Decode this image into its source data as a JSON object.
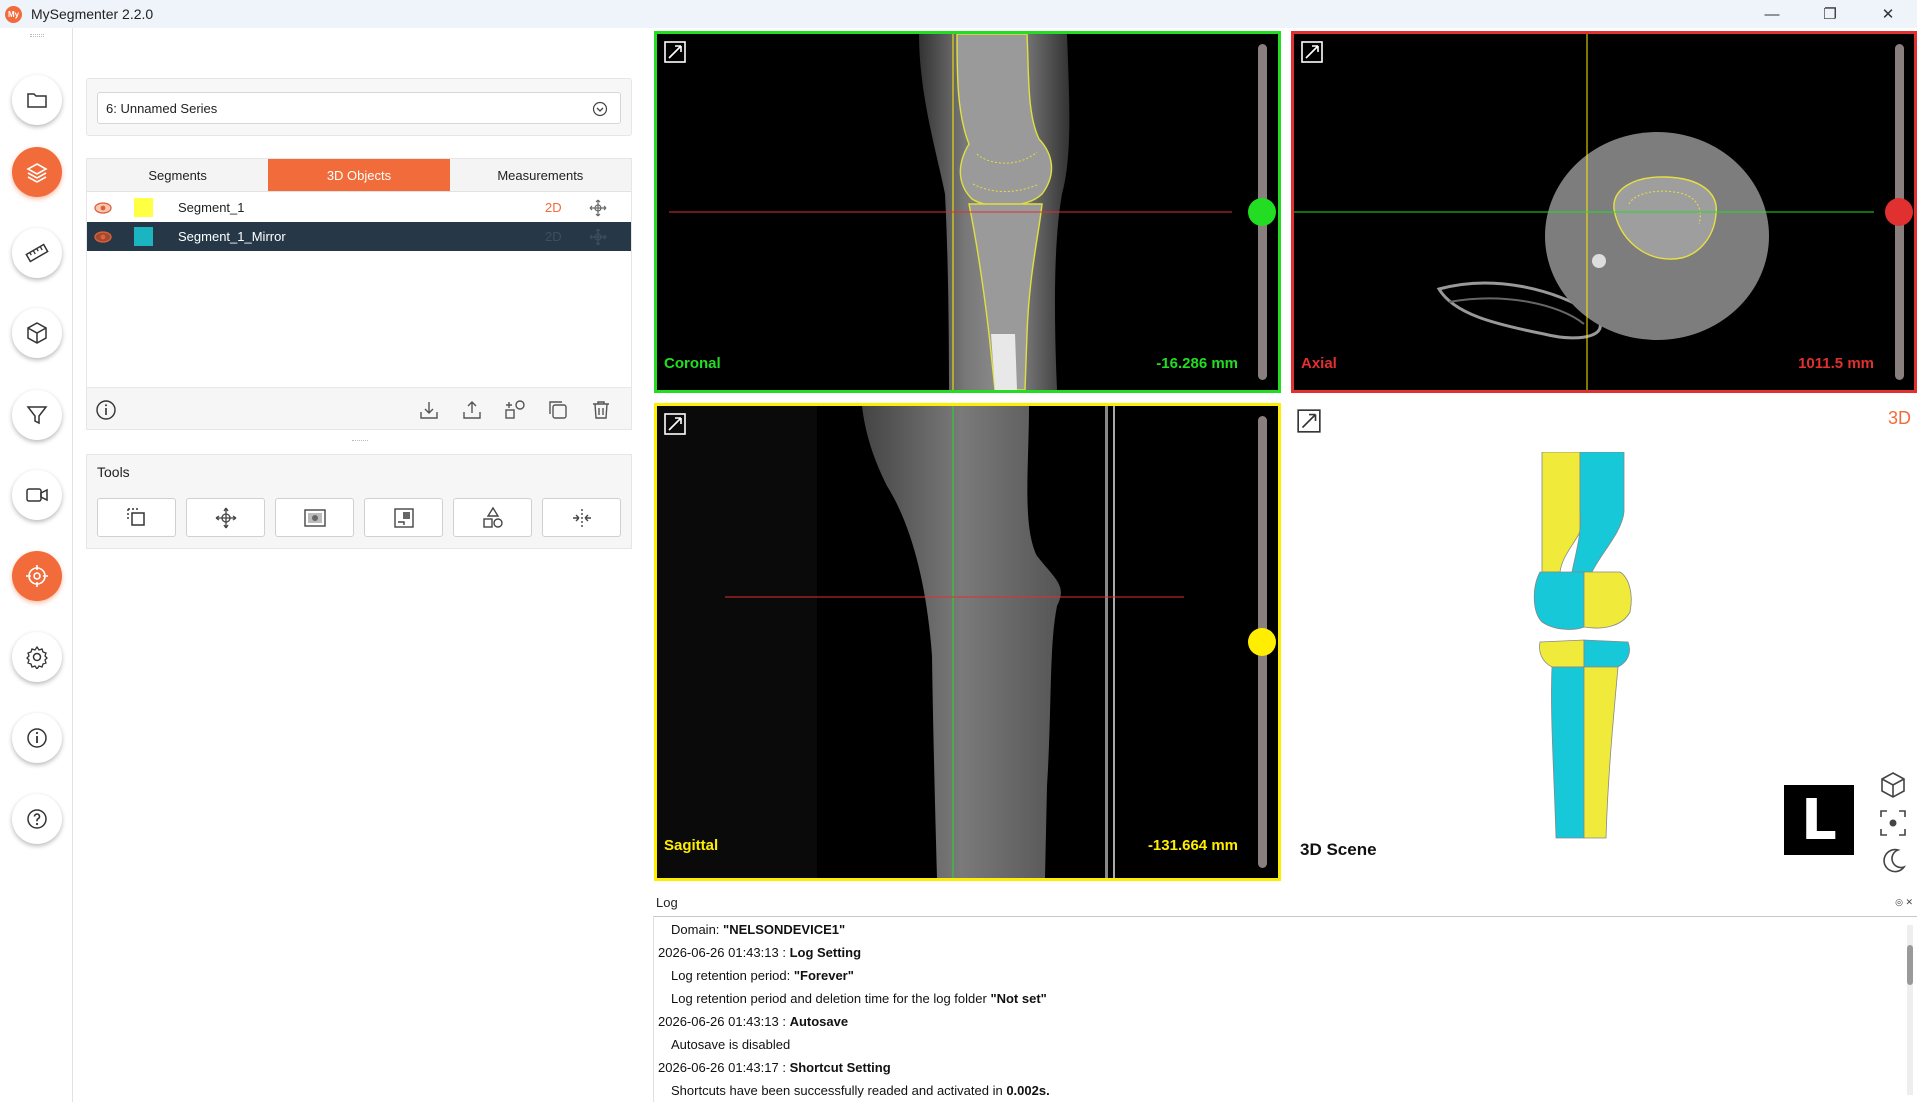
{
  "app": {
    "title": "MySegmenter 2.2.0",
    "logo_text": "My"
  },
  "window_controls": {
    "minimize": "—",
    "restore": "❐",
    "close": "✕"
  },
  "rail": {
    "items": [
      {
        "name": "folder"
      },
      {
        "name": "layers",
        "active": true
      },
      {
        "name": "ruler"
      },
      {
        "name": "cube"
      },
      {
        "name": "filter"
      },
      {
        "name": "video"
      },
      {
        "name": "target",
        "active": true
      },
      {
        "name": "settings"
      },
      {
        "name": "info"
      },
      {
        "name": "help"
      }
    ]
  },
  "series": {
    "selected": "6: Unnamed Series"
  },
  "segments_panel": {
    "tabs": [
      {
        "label": "Segments",
        "active": false
      },
      {
        "label": "3D Objects",
        "active": true
      },
      {
        "label": "Measurements",
        "active": false
      }
    ],
    "rows": [
      {
        "name": "Segment_1",
        "color": "#ffff44",
        "mode": "2D",
        "selected": false
      },
      {
        "name": "Segment_1_Mirror",
        "color": "#1ab5c0",
        "mode": "2D",
        "selected": true
      }
    ]
  },
  "tools": {
    "title": "Tools"
  },
  "views": {
    "coronal": {
      "label": "Coronal",
      "position": "-16.286 mm",
      "color": "#22dd22",
      "slider_fraction": 0.5
    },
    "axial": {
      "label": "Axial",
      "position": "1011.5 mm",
      "color": "#e03030",
      "slider_fraction": 0.5
    },
    "sagittal": {
      "label": "Sagittal",
      "position": "-131.664 mm",
      "color": "#ffee00",
      "slider_fraction": 0.5
    },
    "scene3d": {
      "label": "3D Scene",
      "tag": "3D",
      "orientation": "L",
      "colors": {
        "segment": "#f0ea3a",
        "mirror": "#16c8d8"
      }
    }
  },
  "log": {
    "title": "Log",
    "controls": "◎ ✕",
    "lines": [
      {
        "indent": true,
        "prefix": "Domain: ",
        "bold": "\"NELSONDEVICE1\"",
        "suffix": ""
      },
      {
        "indent": false,
        "prefix": "2026-06-26 01:43:13 : ",
        "bold": "Log Setting",
        "suffix": ""
      },
      {
        "indent": true,
        "prefix": "Log retention period: ",
        "bold": "\"Forever\"",
        "suffix": ""
      },
      {
        "indent": true,
        "prefix": "Log retention period and deletion time for the log folder ",
        "bold": "\"Not set\"",
        "suffix": ""
      },
      {
        "indent": false,
        "prefix": "2026-06-26 01:43:13 : ",
        "bold": "Autosave",
        "suffix": ""
      },
      {
        "indent": true,
        "prefix": "Autosave is disabled",
        "bold": "",
        "suffix": ""
      },
      {
        "indent": false,
        "prefix": "2026-06-26 01:43:17 : ",
        "bold": "Shortcut Setting",
        "suffix": ""
      },
      {
        "indent": true,
        "prefix": "Shortcuts have been successfully readed and activated in ",
        "bold": "0.002s.",
        "suffix": ""
      }
    ]
  }
}
